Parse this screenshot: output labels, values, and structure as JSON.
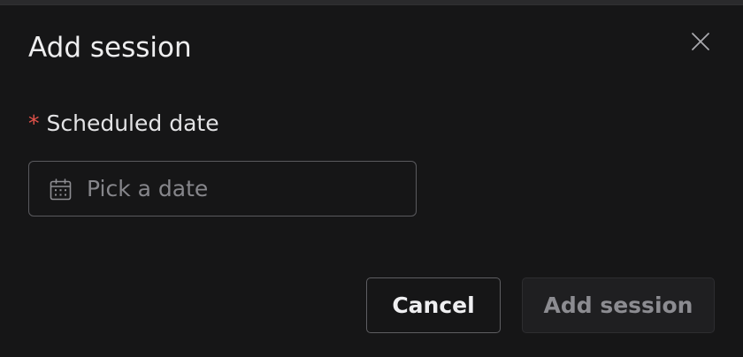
{
  "dialog": {
    "title": "Add session",
    "close_icon": "close-icon"
  },
  "form": {
    "required_marker": "*",
    "date_label": "Scheduled date",
    "date_placeholder": "Pick a date",
    "date_value": "",
    "date_icon": "calendar-icon"
  },
  "footer": {
    "cancel_label": "Cancel",
    "submit_label": "Add session",
    "submit_disabled": true
  },
  "colors": {
    "background": "#161617",
    "required": "#e5534b",
    "text": "#eeeeef",
    "placeholder": "#86868b",
    "disabled_text": "#8c8c91"
  }
}
